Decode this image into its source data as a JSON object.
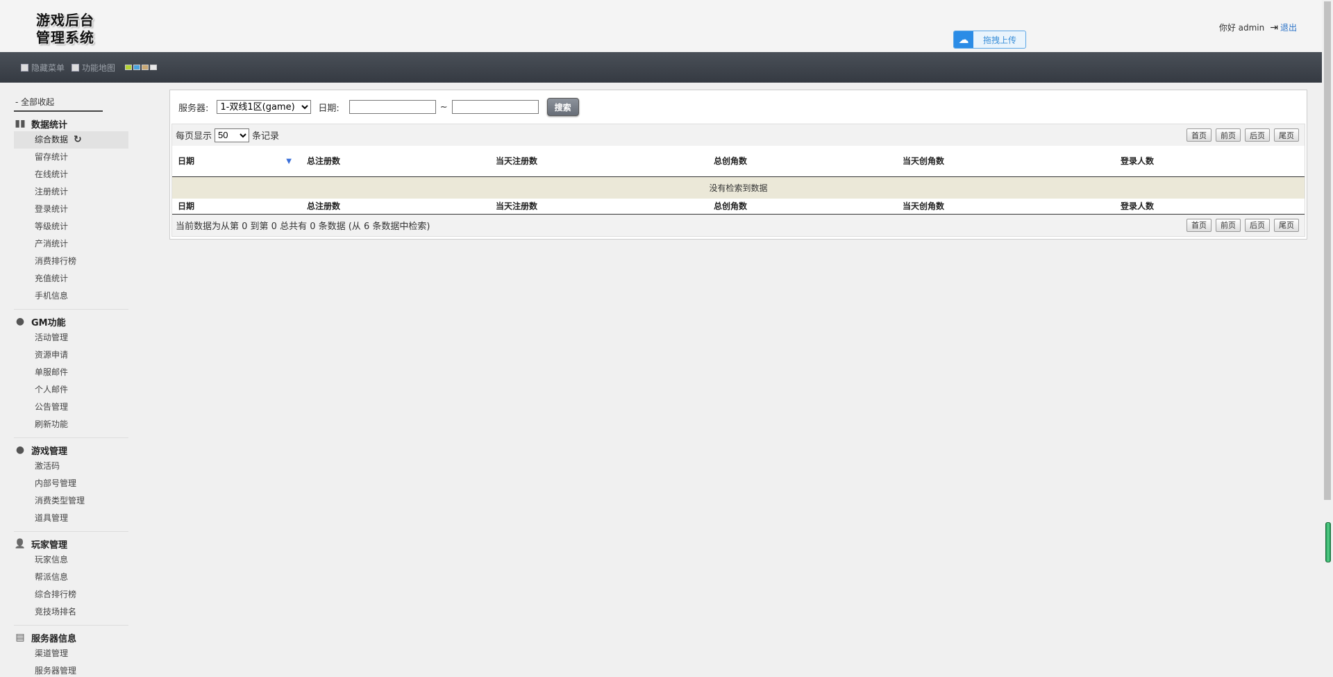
{
  "header": {
    "logo_line1": "游戏后台",
    "logo_line2": "管理系统",
    "upload_label": "拖拽上传",
    "greeting": "你好 admin",
    "logout": "退出"
  },
  "toolbar": {
    "hide_menu": "隐藏菜单",
    "function_map": "功能地图",
    "swatches": [
      "#b5d334",
      "#4aa3df",
      "#c9a874",
      "#e8e8e8"
    ]
  },
  "sidebar": {
    "collapse_all": "- 全部收起",
    "groups": [
      {
        "title": "数据统计",
        "icon": "bar-chart-icon",
        "items": [
          "综合数据",
          "留存统计",
          "在线统计",
          "注册统计",
          "登录统计",
          "等级统计",
          "产消统计",
          "消费排行榜",
          "充值统计",
          "手机信息"
        ]
      },
      {
        "title": "GM功能",
        "icon": "chat-bubbles-icon",
        "items": [
          "活动管理",
          "资源申请",
          "单服邮件",
          "个人邮件",
          "公告管理",
          "刷新功能"
        ]
      },
      {
        "title": "游戏管理",
        "icon": "chat-bubbles-icon",
        "items": [
          "激活码",
          "内部号管理",
          "消费类型管理",
          "道具管理"
        ]
      },
      {
        "title": "玩家管理",
        "icon": "user-icon",
        "items": [
          "玩家信息",
          "帮派信息",
          "综合排行榜",
          "竞技场排名"
        ]
      },
      {
        "title": "服务器信息",
        "icon": "server-icon",
        "items": [
          "渠道管理",
          "服务器管理"
        ]
      }
    ]
  },
  "search": {
    "server_label": "服务器:",
    "server_value": "1-双线1区(game)",
    "date_label": "日期:",
    "tilde": "~",
    "search_button": "搜索"
  },
  "table": {
    "length_prefix": "每页显示",
    "length_value": "50",
    "length_suffix": "条记录",
    "pager": [
      "首页",
      "前页",
      "后页",
      "尾页"
    ],
    "columns": [
      "日期",
      "总注册数",
      "当天注册数",
      "总创角数",
      "当天创角数",
      "登录人数"
    ],
    "empty_text": "没有检索到数据",
    "info_text": "当前数据为从第 0 到第 0 总共有 0 条数据 (从 6 条数据中检索)"
  }
}
